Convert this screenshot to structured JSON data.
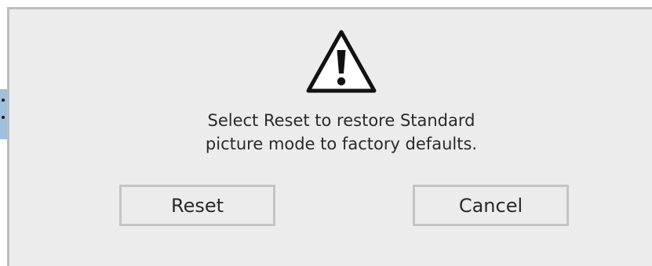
{
  "dialog": {
    "icon": "warning-triangle-icon",
    "message_lines": [
      "Select Reset to restore Standard",
      "picture mode to factory defaults."
    ],
    "buttons": {
      "reset_label": "Reset",
      "cancel_label": "Cancel"
    }
  },
  "colors": {
    "dialog_background": "#ececec",
    "button_border": "#c4c4c4",
    "side_tab": "#9fc0da",
    "text": "#2a2a2a"
  }
}
